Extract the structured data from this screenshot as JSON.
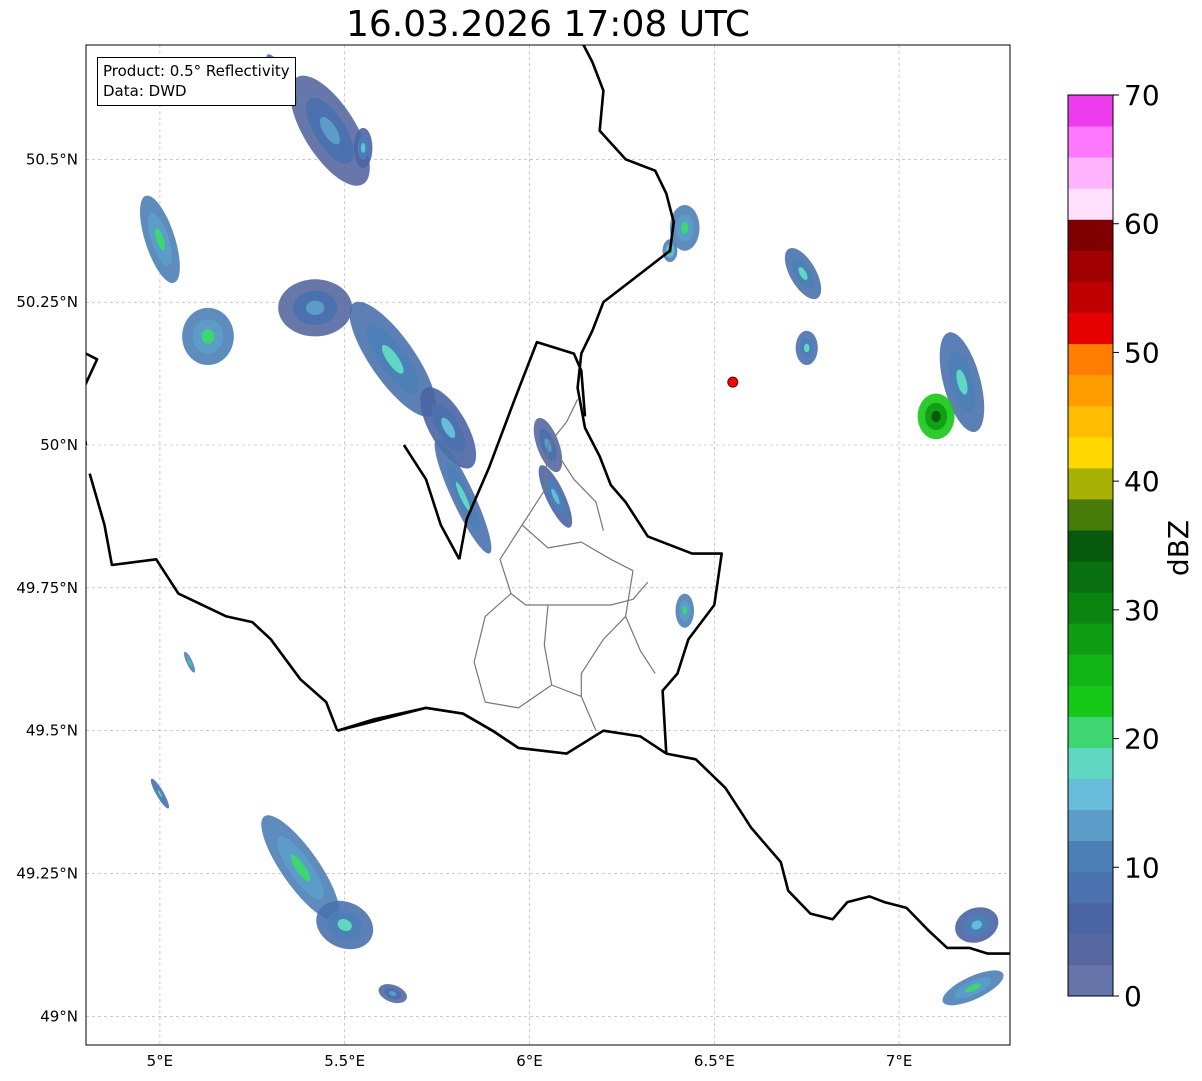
{
  "title": "16.03.2026 17:08 UTC",
  "info_box": {
    "product": "Product: 0.5° Reflectivity",
    "source": "Data: DWD"
  },
  "axes": {
    "lon_range": [
      4.8,
      7.3
    ],
    "lat_range": [
      48.95,
      50.7
    ],
    "x_ticks": [
      {
        "value": 5.0,
        "label": "5°E"
      },
      {
        "value": 5.5,
        "label": "5.5°E"
      },
      {
        "value": 6.0,
        "label": "6°E"
      },
      {
        "value": 6.5,
        "label": "6.5°E"
      },
      {
        "value": 7.0,
        "label": "7°E"
      }
    ],
    "y_ticks": [
      {
        "value": 50.5,
        "label": "50.5°N"
      },
      {
        "value": 50.25,
        "label": "50.25°N"
      },
      {
        "value": 50.0,
        "label": "50°N"
      },
      {
        "value": 49.75,
        "label": "49.75°N"
      },
      {
        "value": 49.5,
        "label": "49.5°N"
      },
      {
        "value": 49.25,
        "label": "49.25°N"
      },
      {
        "value": 49.0,
        "label": "49°N"
      }
    ],
    "grid": true
  },
  "radar_site": {
    "lon": 6.55,
    "lat": 50.11,
    "color": "#ff0000"
  },
  "colorbar": {
    "label": "dBZ",
    "min": 0,
    "max": 70,
    "ticks": [
      0,
      10,
      20,
      30,
      40,
      50,
      60,
      70
    ],
    "colors": [
      "#6675a9",
      "#5768a0",
      "#4a64a4",
      "#4a72ae",
      "#4b7fb6",
      "#5b9dc8",
      "#66bcd9",
      "#60d7c3",
      "#3ed671",
      "#15c716",
      "#12b516",
      "#0f9d13",
      "#0b8412",
      "#0a7012",
      "#075a0d",
      "#477c0a",
      "#a8b104",
      "#ffd800",
      "#ffbc00",
      "#ff9c00",
      "#ff7d00",
      "#e60000",
      "#c00000",
      "#a00000",
      "#7f0000",
      "#ffe0ff",
      "#ffb4ff",
      "#ff78ff",
      "#ec3ced"
    ]
  },
  "precip_cells": [
    {
      "lon": 5.46,
      "lat": 50.55,
      "rx": 0.07,
      "ry": 0.11,
      "rot": -32,
      "dbz": 8
    },
    {
      "lon": 5.33,
      "lat": 50.64,
      "rx": 0.02,
      "ry": 0.05,
      "rot": -30,
      "dbz": 12
    },
    {
      "lon": 5.0,
      "lat": 50.36,
      "rx": 0.04,
      "ry": 0.08,
      "rot": -18,
      "dbz": 14
    },
    {
      "lon": 5.13,
      "lat": 50.19,
      "rx": 0.07,
      "ry": 0.05,
      "rot": 0,
      "dbz": 14
    },
    {
      "lon": 5.42,
      "lat": 50.24,
      "rx": 0.1,
      "ry": 0.05,
      "rot": 0,
      "dbz": 8
    },
    {
      "lon": 5.63,
      "lat": 50.15,
      "rx": 0.06,
      "ry": 0.12,
      "rot": -35,
      "dbz": 12
    },
    {
      "lon": 5.78,
      "lat": 50.03,
      "rx": 0.05,
      "ry": 0.08,
      "rot": -30,
      "dbz": 9
    },
    {
      "lon": 5.82,
      "lat": 49.91,
      "rx": 0.03,
      "ry": 0.11,
      "rot": -25,
      "dbz": 12
    },
    {
      "lon": 6.07,
      "lat": 49.91,
      "rx": 0.025,
      "ry": 0.06,
      "rot": -25,
      "dbz": 10
    },
    {
      "lon": 6.42,
      "lat": 50.38,
      "rx": 0.04,
      "ry": 0.04,
      "rot": 0,
      "dbz": 14
    },
    {
      "lon": 6.38,
      "lat": 50.34,
      "rx": 0.02,
      "ry": 0.02,
      "rot": 0,
      "dbz": 16
    },
    {
      "lon": 6.74,
      "lat": 50.3,
      "rx": 0.035,
      "ry": 0.05,
      "rot": -30,
      "dbz": 12
    },
    {
      "lon": 6.75,
      "lat": 50.17,
      "rx": 0.03,
      "ry": 0.03,
      "rot": 0,
      "dbz": 12
    },
    {
      "lon": 7.17,
      "lat": 50.11,
      "rx": 0.05,
      "ry": 0.09,
      "rot": -15,
      "dbz": 12
    },
    {
      "lon": 7.1,
      "lat": 50.05,
      "rx": 0.05,
      "ry": 0.04,
      "rot": 0,
      "dbz": 28
    },
    {
      "lon": 6.42,
      "lat": 49.71,
      "rx": 0.025,
      "ry": 0.03,
      "rot": 0,
      "dbz": 14
    },
    {
      "lon": 5.38,
      "lat": 49.26,
      "rx": 0.05,
      "ry": 0.11,
      "rot": -35,
      "dbz": 14
    },
    {
      "lon": 5.5,
      "lat": 49.16,
      "rx": 0.08,
      "ry": 0.04,
      "rot": 25,
      "dbz": 12
    },
    {
      "lon": 5.63,
      "lat": 49.04,
      "rx": 0.04,
      "ry": 0.015,
      "rot": 20,
      "dbz": 8
    },
    {
      "lon": 5.0,
      "lat": 49.39,
      "rx": 0.01,
      "ry": 0.03,
      "rot": -30,
      "dbz": 12
    },
    {
      "lon": 5.08,
      "lat": 49.62,
      "rx": 0.008,
      "ry": 0.02,
      "rot": -25,
      "dbz": 14
    },
    {
      "lon": 7.21,
      "lat": 49.16,
      "rx": 0.06,
      "ry": 0.03,
      "rot": -20,
      "dbz": 10
    },
    {
      "lon": 7.2,
      "lat": 49.05,
      "rx": 0.09,
      "ry": 0.02,
      "rot": -25,
      "dbz": 14
    },
    {
      "lon": 5.55,
      "lat": 50.52,
      "rx": 0.025,
      "ry": 0.035,
      "rot": 0,
      "dbz": 10
    },
    {
      "lon": 6.05,
      "lat": 50.0,
      "rx": 0.03,
      "ry": 0.05,
      "rot": -20,
      "dbz": 8
    }
  ],
  "borders": {
    "country": [
      [
        [
          6.13,
          50.72
        ],
        [
          6.17,
          50.67
        ],
        [
          6.2,
          50.62
        ],
        [
          6.19,
          50.55
        ],
        [
          6.26,
          50.5
        ],
        [
          6.34,
          50.48
        ],
        [
          6.37,
          50.44
        ],
        [
          6.39,
          50.39
        ],
        [
          6.38,
          50.34
        ],
        [
          6.3,
          50.3
        ],
        [
          6.2,
          50.25
        ],
        [
          6.17,
          50.2
        ],
        [
          6.14,
          50.16
        ],
        [
          6.13,
          50.1
        ],
        [
          6.15,
          50.03
        ],
        [
          6.19,
          49.98
        ],
        [
          6.22,
          49.93
        ],
        [
          6.26,
          49.9
        ],
        [
          6.32,
          49.84
        ],
        [
          6.44,
          49.81
        ],
        [
          6.52,
          49.81
        ],
        [
          6.5,
          49.72
        ],
        [
          6.43,
          49.66
        ],
        [
          6.4,
          49.6
        ],
        [
          6.36,
          49.57
        ],
        [
          6.37,
          49.46
        ],
        [
          6.3,
          49.49
        ],
        [
          6.2,
          49.5
        ],
        [
          6.1,
          49.46
        ],
        [
          5.97,
          49.47
        ],
        [
          5.9,
          49.5
        ],
        [
          5.82,
          49.53
        ],
        [
          5.72,
          49.54
        ],
        [
          5.6,
          49.52
        ],
        [
          5.48,
          49.5
        ]
      ],
      [
        [
          5.48,
          49.5
        ],
        [
          5.45,
          49.55
        ],
        [
          5.38,
          49.59
        ],
        [
          5.3,
          49.66
        ],
        [
          5.25,
          49.69
        ],
        [
          5.18,
          49.7
        ],
        [
          5.05,
          49.74
        ],
        [
          4.99,
          49.8
        ],
        [
          4.87,
          49.79
        ],
        [
          4.85,
          49.86
        ],
        [
          4.81,
          49.95
        ]
      ],
      [
        [
          4.8,
          50.16
        ],
        [
          4.83,
          50.15
        ],
        [
          4.78,
          50.08
        ],
        [
          4.8,
          50.0
        ]
      ],
      [
        [
          6.37,
          49.46
        ],
        [
          6.45,
          49.45
        ],
        [
          6.53,
          49.4
        ],
        [
          6.58,
          49.35
        ],
        [
          6.6,
          49.33
        ],
        [
          6.68,
          49.27
        ],
        [
          6.7,
          49.22
        ],
        [
          6.76,
          49.18
        ],
        [
          6.82,
          49.17
        ],
        [
          6.86,
          49.2
        ],
        [
          6.92,
          49.21
        ],
        [
          6.96,
          49.2
        ],
        [
          7.02,
          49.19
        ],
        [
          7.08,
          49.15
        ],
        [
          7.13,
          49.12
        ],
        [
          7.19,
          49.12
        ],
        [
          7.24,
          49.11
        ],
        [
          7.3,
          49.11
        ]
      ],
      [
        [
          5.48,
          49.5
        ],
        [
          5.58,
          49.52
        ],
        [
          5.72,
          49.54
        ],
        [
          5.82,
          49.53
        ],
        [
          5.9,
          49.5
        ],
        [
          5.97,
          49.47
        ]
      ],
      [
        [
          5.81,
          49.8
        ],
        [
          5.83,
          49.87
        ],
        [
          5.89,
          49.96
        ],
        [
          5.96,
          50.08
        ],
        [
          6.02,
          50.18
        ],
        [
          6.12,
          50.16
        ],
        [
          6.14,
          50.13
        ],
        [
          6.15,
          50.05
        ]
      ],
      [
        [
          5.81,
          49.8
        ],
        [
          5.76,
          49.86
        ],
        [
          5.72,
          49.94
        ],
        [
          5.66,
          50.0
        ]
      ]
    ],
    "regional": [
      [
        [
          6.13,
          50.08
        ],
        [
          6.1,
          50.04
        ],
        [
          6.05,
          50.0
        ],
        [
          6.04,
          49.92
        ],
        [
          5.98,
          49.86
        ],
        [
          6.05,
          49.82
        ],
        [
          6.14,
          49.83
        ],
        [
          6.22,
          49.8
        ],
        [
          6.28,
          49.78
        ]
      ],
      [
        [
          5.98,
          49.86
        ],
        [
          5.92,
          49.8
        ],
        [
          5.95,
          49.74
        ],
        [
          5.99,
          49.72
        ],
        [
          6.05,
          49.72
        ]
      ],
      [
        [
          6.05,
          49.72
        ],
        [
          6.14,
          49.72
        ],
        [
          6.22,
          49.72
        ],
        [
          6.28,
          49.73
        ],
        [
          6.32,
          49.76
        ]
      ],
      [
        [
          6.05,
          49.72
        ],
        [
          6.04,
          49.65
        ],
        [
          6.06,
          49.58
        ],
        [
          6.14,
          49.56
        ],
        [
          6.18,
          49.5
        ]
      ],
      [
        [
          5.95,
          49.74
        ],
        [
          5.88,
          49.7
        ],
        [
          5.85,
          49.62
        ],
        [
          5.88,
          49.55
        ],
        [
          5.97,
          49.54
        ],
        [
          6.06,
          49.58
        ]
      ],
      [
        [
          6.28,
          49.78
        ],
        [
          6.26,
          49.7
        ],
        [
          6.3,
          49.64
        ],
        [
          6.34,
          49.6
        ]
      ],
      [
        [
          6.26,
          49.7
        ],
        [
          6.2,
          49.66
        ],
        [
          6.14,
          49.6
        ],
        [
          6.14,
          49.56
        ]
      ],
      [
        [
          6.08,
          49.98
        ],
        [
          6.12,
          49.94
        ],
        [
          6.18,
          49.9
        ],
        [
          6.2,
          49.85
        ]
      ]
    ]
  }
}
